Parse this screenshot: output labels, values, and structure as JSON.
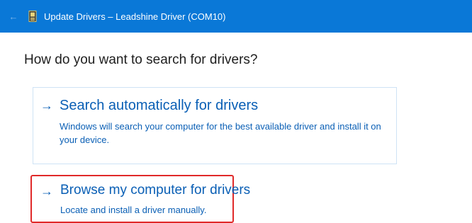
{
  "window": {
    "title": "Update Drivers – Leadshine Driver (COM10)",
    "back_icon": "back-arrow-icon",
    "device_icon": "device-driver-icon",
    "accent_color": "#0a78d7"
  },
  "main": {
    "heading": "How do you want to search for drivers?",
    "options": [
      {
        "arrow": "→",
        "title": "Search automatically for drivers",
        "description": "Windows will search your computer for the best available driver and install it on your device."
      },
      {
        "arrow": "→",
        "title": "Browse my computer for drivers",
        "description": "Locate and install a driver manually.",
        "highlight_color": "#e02a2a"
      }
    ]
  }
}
